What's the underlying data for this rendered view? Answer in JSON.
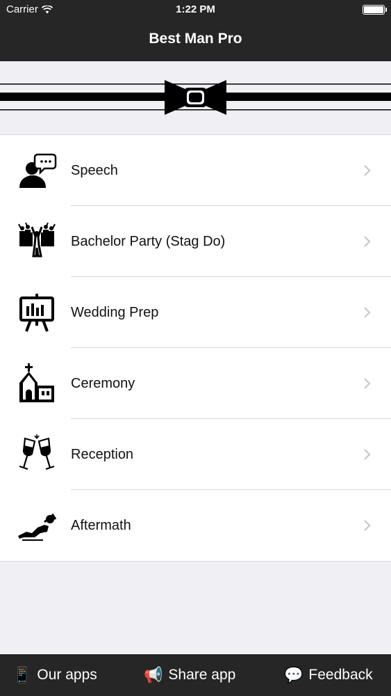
{
  "status_bar": {
    "carrier": "Carrier",
    "time": "1:22 PM"
  },
  "nav": {
    "title": "Best Man Pro"
  },
  "menu": [
    {
      "label": "Speech",
      "icon": "speech-person-icon"
    },
    {
      "label": "Bachelor Party (Stag Do)",
      "icon": "party-crowd-icon"
    },
    {
      "label": "Wedding Prep",
      "icon": "presentation-board-icon"
    },
    {
      "label": "Ceremony",
      "icon": "church-icon"
    },
    {
      "label": "Reception",
      "icon": "champagne-toast-icon"
    },
    {
      "label": "Aftermath",
      "icon": "reclining-person-icon"
    }
  ],
  "bottom_bar": {
    "our_apps": "Our apps",
    "share_app": "Share app",
    "feedback": "Feedback"
  },
  "colors": {
    "bar": "#262626",
    "background": "#efeff4",
    "chevron": "#c7c7cc"
  }
}
